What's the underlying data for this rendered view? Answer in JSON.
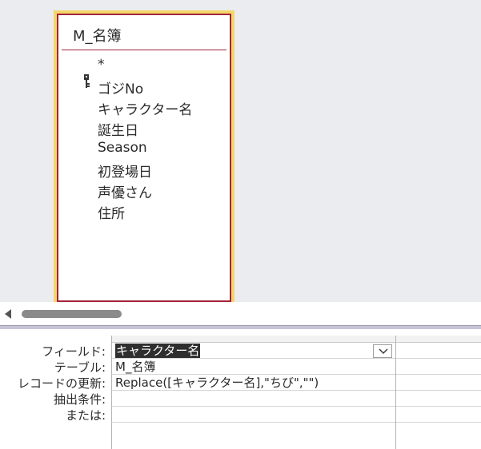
{
  "table": {
    "title": "M_名簿",
    "fields": [
      "*",
      "ゴジNo",
      "キャラクター名",
      "誕生日",
      "Season",
      "初登場日",
      "声優さん",
      "住所"
    ],
    "key_icon": "primary-key-icon"
  },
  "grid": {
    "labels": {
      "field": "フィールド:",
      "table": "テーブル:",
      "update": "レコードの更新:",
      "criteria": "抽出条件:",
      "or": "または:"
    },
    "column1": {
      "field": "キャラクター名",
      "table": "M_名簿",
      "update": "Replace([キャラクター名],\"ちび\",\"\")",
      "criteria": "",
      "or": ""
    }
  },
  "colors": {
    "table_border": "#a1253a",
    "selection_outline": "#f5d66a",
    "design_bg": "#eaecef"
  }
}
